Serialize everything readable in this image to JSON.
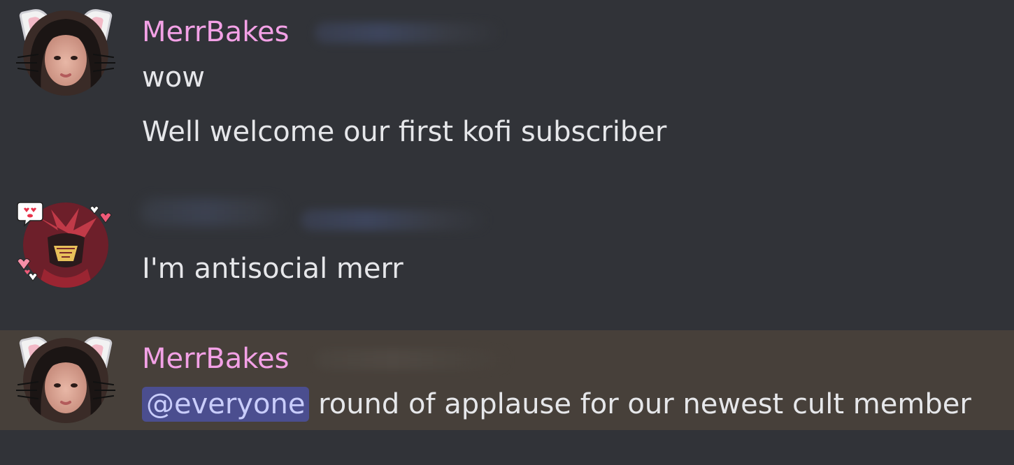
{
  "messages": [
    {
      "username": "MerrBakes",
      "lines": [
        "wow",
        "Well welcome our first kofi subscriber"
      ]
    },
    {
      "username": "",
      "lines": [
        "I'm antisocial merr"
      ]
    },
    {
      "username": "MerrBakes",
      "mention": "@everyone",
      "text": " round of applause for our newest cult member"
    }
  ],
  "colors": {
    "background": "#313338",
    "highlight": "#47403a",
    "username": "#f3a1e6",
    "text": "#e6e7ea",
    "mention_bg": "#4b4e8f",
    "mention_text": "#c9cdfb"
  }
}
